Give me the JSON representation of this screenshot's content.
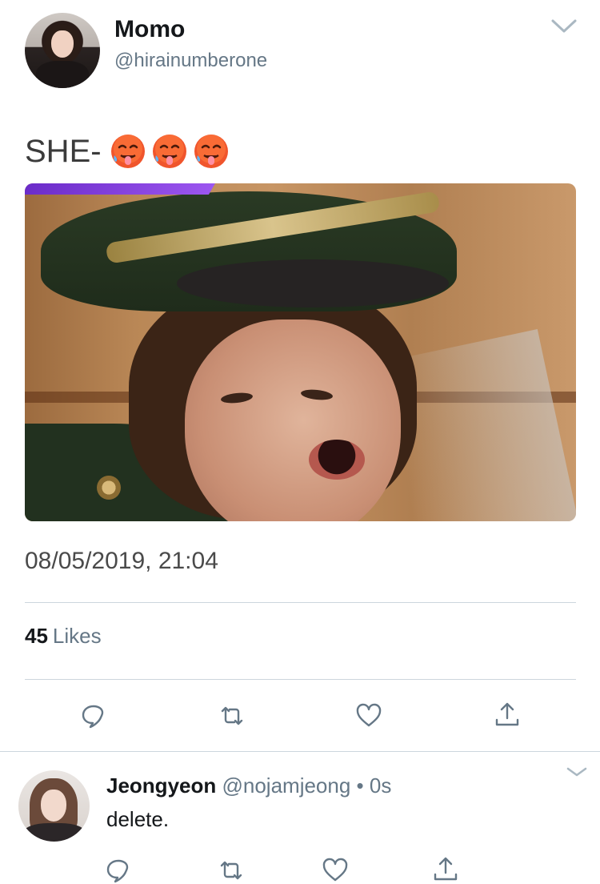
{
  "tweet": {
    "author": {
      "display_name": "Momo",
      "handle": "@hirainumberone"
    },
    "text": "SHE-",
    "emoji": [
      "hot-face-emoji",
      "hot-face-emoji",
      "hot-face-emoji"
    ],
    "timestamp": "08/05/2019, 21:04",
    "likes": {
      "count": "45",
      "label": "Likes"
    },
    "actions": [
      "reply-icon",
      "retweet-icon",
      "like-icon",
      "share-icon"
    ]
  },
  "reply": {
    "author": {
      "display_name": "Jeongyeon",
      "handle": "@nojamjeong",
      "separator": "•",
      "time": "0s"
    },
    "text": "delete.",
    "actions": [
      "reply-icon",
      "retweet-icon",
      "like-icon",
      "share-icon"
    ]
  },
  "colors": {
    "primary_text": "#14171a",
    "secondary_text": "#657786",
    "divider": "#ccd6dd",
    "icon": "#657786"
  }
}
